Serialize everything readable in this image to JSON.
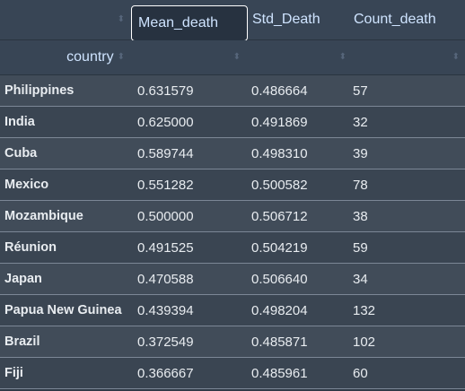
{
  "columns": {
    "mean": "Mean_death",
    "std": "Std_Death",
    "count": "Count_death",
    "index": "country"
  },
  "rows": [
    {
      "country": "Philippines",
      "mean": "0.631579",
      "std": "0.486664",
      "count": "57"
    },
    {
      "country": "India",
      "mean": "0.625000",
      "std": "0.491869",
      "count": "32"
    },
    {
      "country": "Cuba",
      "mean": "0.589744",
      "std": "0.498310",
      "count": "39"
    },
    {
      "country": "Mexico",
      "mean": "0.551282",
      "std": "0.500582",
      "count": "78"
    },
    {
      "country": "Mozambique",
      "mean": "0.500000",
      "std": "0.506712",
      "count": "38"
    },
    {
      "country": "Réunion",
      "mean": "0.491525",
      "std": "0.504219",
      "count": "59"
    },
    {
      "country": "Japan",
      "mean": "0.470588",
      "std": "0.506640",
      "count": "34"
    },
    {
      "country": "Papua New Guinea",
      "mean": "0.439394",
      "std": "0.498204",
      "count": "132"
    },
    {
      "country": "Brazil",
      "mean": "0.372549",
      "std": "0.485871",
      "count": "102"
    },
    {
      "country": "Fiji",
      "mean": "0.366667",
      "std": "0.485961",
      "count": "60"
    }
  ],
  "icons": {
    "sort": "sort-arrows-icon"
  }
}
